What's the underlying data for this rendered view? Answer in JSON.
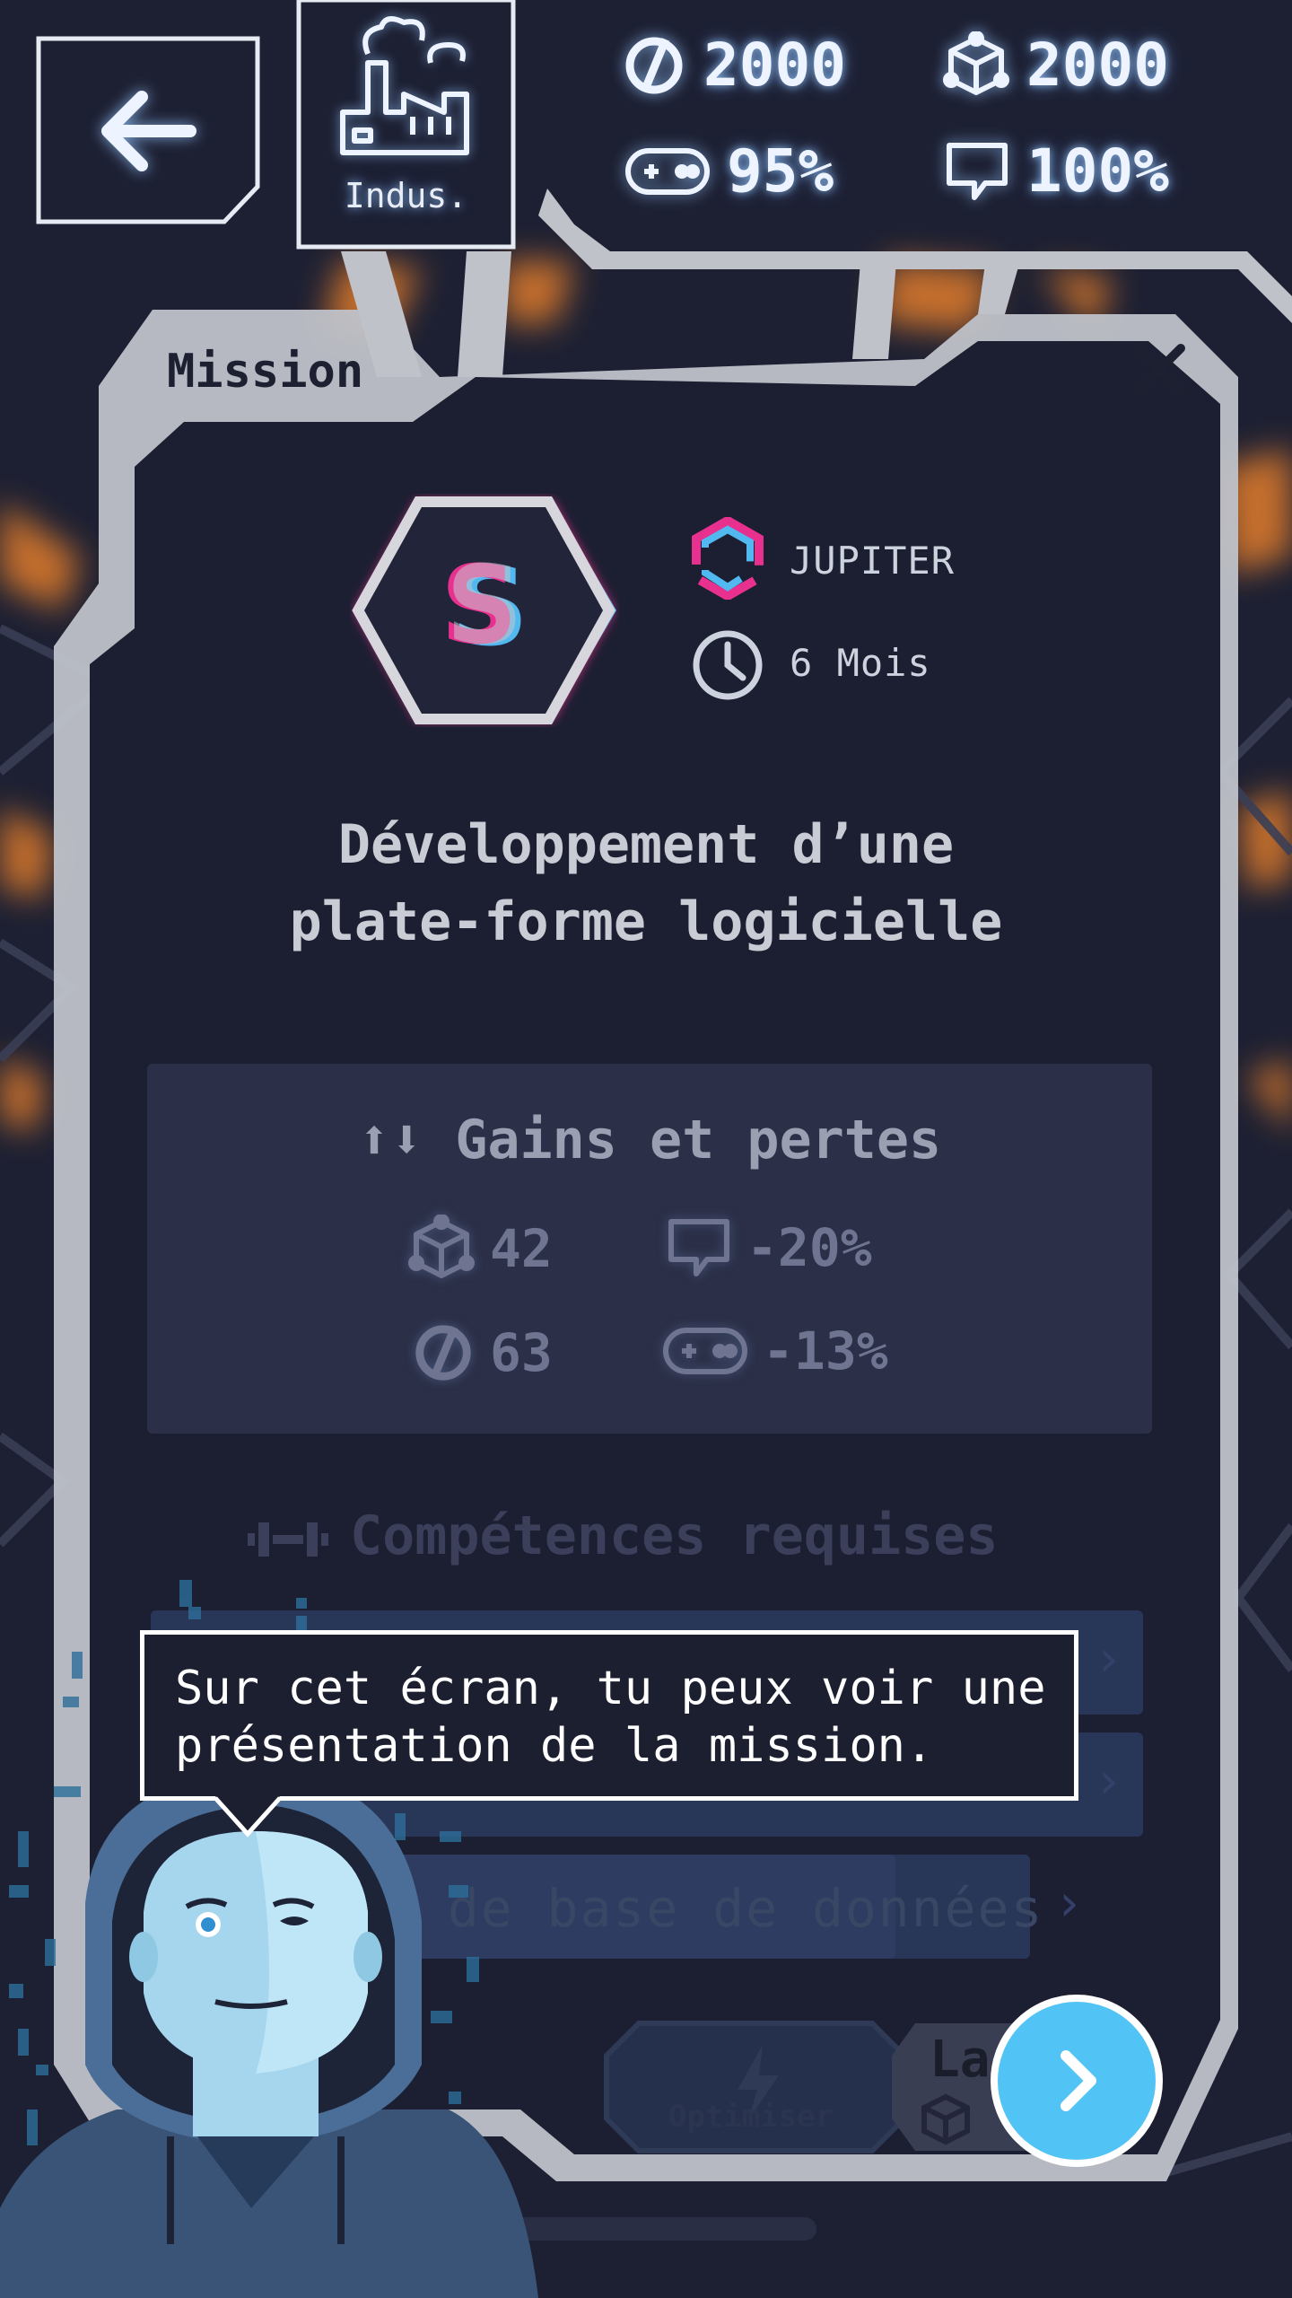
{
  "header": {
    "back_icon": "arrow-left-icon",
    "category": {
      "icon": "factory-icon",
      "label": "Indus."
    },
    "stats": [
      {
        "icon": "money-icon",
        "value": "2000"
      },
      {
        "icon": "cube-icon",
        "value": "2000"
      },
      {
        "icon": "gamepad-icon",
        "value": "95%"
      },
      {
        "icon": "chat-icon",
        "value": "100%"
      }
    ]
  },
  "mission": {
    "tab_label": "Mission",
    "close_icon": "close-icon",
    "grade": "S",
    "client": "JUPITER",
    "duration": "6 Mois",
    "title_line1": "Développement d’une",
    "title_line2": "plate-forme logicielle"
  },
  "gains": {
    "title": "Gains et pertes",
    "items": [
      {
        "icon": "cube-icon",
        "value": "42"
      },
      {
        "icon": "chat-icon",
        "value": "-20%"
      },
      {
        "icon": "money-icon",
        "value": "63"
      },
      {
        "icon": "gamepad-icon",
        "value": "-13%"
      }
    ]
  },
  "skills": {
    "title": "Compétences requises",
    "partial_row": "n de base de données"
  },
  "actions": {
    "optimize": "Optimiser",
    "launch_partial": "La"
  },
  "tutorial": {
    "text": "Sur cet écran, tu peux voir une\nprésentation de la mission."
  },
  "colors": {
    "background": "#1d2033",
    "frame": "#c7c9ce",
    "accent_orange": "#ff8a2a",
    "accent_blue": "#52c3f5",
    "grade_pink": "#e8318f"
  }
}
